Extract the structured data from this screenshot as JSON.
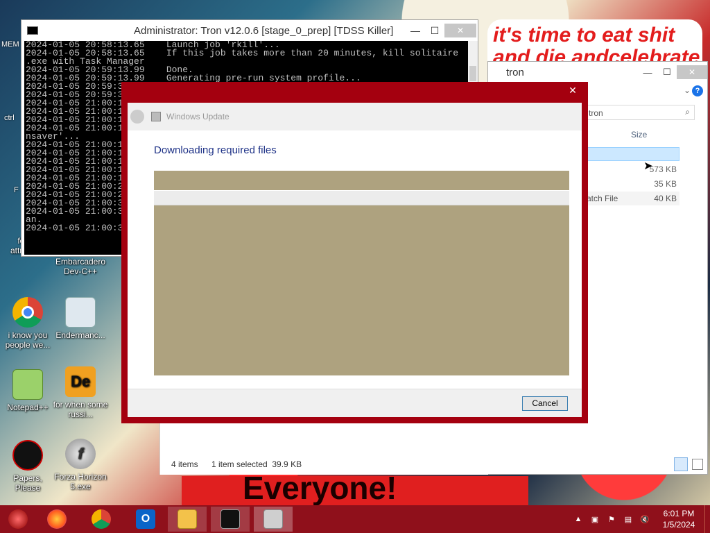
{
  "desktop": {
    "banner_text": "it's time to eat shit",
    "banner_text_2": "and die andcelebrate",
    "bottom_text": "Everyone!",
    "partial_labels": {
      "mem": "MEM",
      "ctrl": "ctrl",
      "f": "F"
    },
    "icons": [
      {
        "label": "forkie attractant",
        "icon": "folder-icon"
      },
      {
        "label": "Embarcadero Dev-C++",
        "icon": "devcpp-icon"
      },
      {
        "label": "i know you people we...",
        "icon": "chrome-icon"
      },
      {
        "label": "Endermanc...",
        "icon": "app-icon"
      },
      {
        "label": "Notepad++",
        "icon": "notepadpp-icon"
      },
      {
        "label": "for when some russi...",
        "icon": "de-icon"
      },
      {
        "label": "Papers, Please",
        "icon": "game-icon"
      },
      {
        "label": "Forza Horizon 5.exe",
        "icon": "flash-icon"
      }
    ]
  },
  "console": {
    "title": "Administrator:  Tron v12.0.6 [stage_0_prep] [TDSS Killer]",
    "lines": [
      "2024-01-05 20:58:13.65    Launch job 'rkill'...",
      "2024-01-05 20:58:13.65    If this job takes more than 20 minutes, kill solitaire",
      ".exe with Task Manager",
      "2024-01-05 20:59:13.99    Done.",
      "2024-01-05 20:59:13.99    Generating pre-run system profile...",
      "2024-01-05 20:59:3",
      "2024-01-05 20:59:3",
      "2024-01-05 21:00:1",
      "2024-01-05 21:00:1",
      "2024-01-05 21:00:1",
      "2024-01-05 21:00:1",
      "nsaver'...",
      "2024-01-05 21:00:1",
      "2024-01-05 21:00:1",
      "2024-01-05 21:00:1",
      "2024-01-05 21:00:1",
      "2024-01-05 21:00:1",
      "2024-01-05 21:00:2",
      "2024-01-05 21:00:2",
      "2024-01-05 21:00:3",
      "2024-01-05 21:00:3",
      "an.",
      "2024-01-05 21:00:3"
    ]
  },
  "explorer": {
    "title": "tron",
    "search_text": "tron",
    "column_size": "Size",
    "rows": [
      {
        "name": "",
        "size": ""
      },
      {
        "name": "",
        "size": "573 KB"
      },
      {
        "name": "",
        "size": "35 KB"
      },
      {
        "name": "atch File",
        "size": "40 KB"
      }
    ],
    "status_items": "4 items",
    "status_selected": "1 item selected  39.9 KB"
  },
  "dialog": {
    "app_title": "Windows Update",
    "heading": "Downloading required files",
    "cancel_label": "Cancel",
    "close_glyph": "✕"
  },
  "taskbar": {
    "time": "6:01 PM",
    "date": "1/5/2024",
    "apps": [
      "firefox-icon",
      "chrome-icon",
      "outlook-icon",
      "file-explorer-icon",
      "console-icon",
      "installer-icon"
    ]
  },
  "colors": {
    "dialog_frame": "#a4000f",
    "taskbar": "#8f101b",
    "panel": "#aea27f",
    "heading": "#1e3287"
  }
}
